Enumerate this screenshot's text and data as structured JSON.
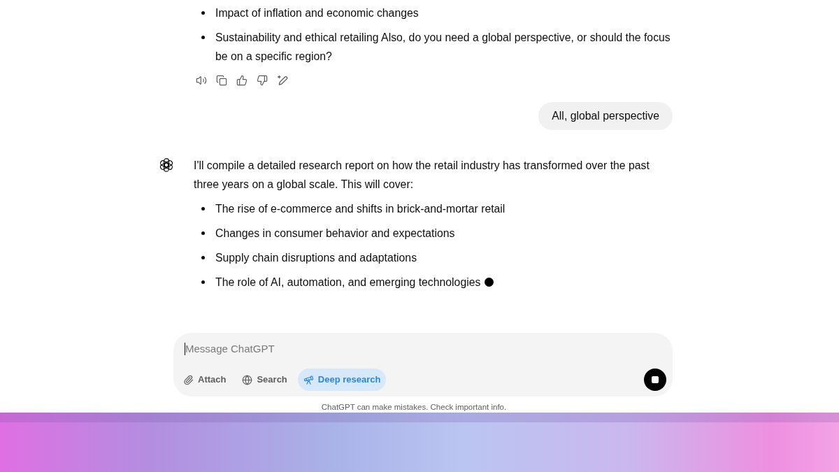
{
  "messages": [
    {
      "kind": "assistant",
      "bullets": [
        "Impact of inflation and economic changes",
        "Sustainability and ethical retailing Also, do you need a global perspective, or should the focus be on a specific region?"
      ],
      "streaming": false
    },
    {
      "kind": "user",
      "text": "All, global perspective"
    },
    {
      "kind": "assistant",
      "intro": "I'll compile a detailed research report on how the retail industry has transformed over the past three years on a global scale. This will cover:",
      "bullets": [
        "The rise of e-commerce and shifts in brick-and-mortar retail",
        "Changes in consumer behavior and expectations",
        "Supply chain disruptions and adaptations",
        "The role of AI, automation, and emerging technologies"
      ],
      "streaming": true
    }
  ],
  "composer": {
    "placeholder": "Message ChatGPT",
    "tools": [
      {
        "kind": "attach",
        "label": "Attach",
        "selected": false
      },
      {
        "kind": "search",
        "label": "Search",
        "selected": false
      },
      {
        "kind": "research",
        "label": "Deep research",
        "selected": true
      }
    ],
    "generating": true
  },
  "disclaimer": "ChatGPT can make mistakes. Check important info."
}
